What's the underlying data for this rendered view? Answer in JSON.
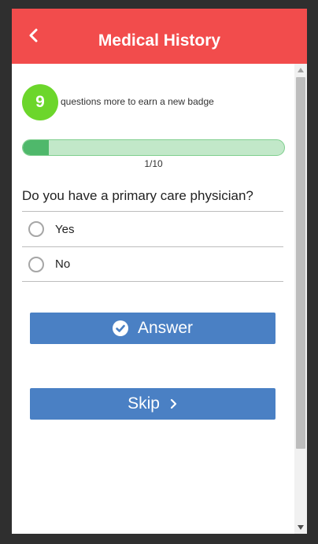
{
  "header": {
    "title": "Medical History",
    "back_icon": "chevron-left-icon"
  },
  "badge": {
    "count": "9",
    "text": "questions more to earn a new badge"
  },
  "progress": {
    "label": "1/10",
    "fraction": 0.1,
    "fill_color": "#4fb86b",
    "track_color": "#c2e8c9"
  },
  "question": {
    "text": "Do you have a primary care physician?"
  },
  "options": [
    {
      "label": "Yes"
    },
    {
      "label": "No"
    }
  ],
  "buttons": {
    "answer_label": "Answer",
    "skip_label": "Skip"
  },
  "colors": {
    "header": "#f24c4c",
    "badge": "#6cd62b",
    "button": "#4a80c4"
  }
}
